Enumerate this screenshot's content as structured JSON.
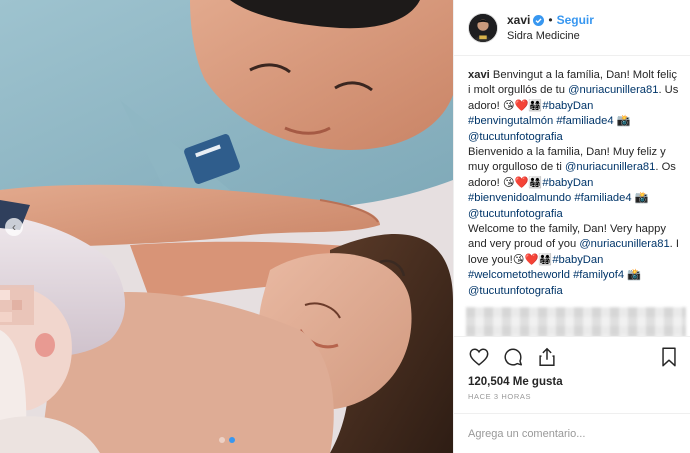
{
  "post": {
    "author": {
      "username": "xavi",
      "verified": true,
      "follow_label": "Seguir",
      "separator": "•",
      "location": "Sidra Medicine"
    },
    "media": {
      "carousel_current": 2,
      "carousel_total": 2,
      "prev_icon": "‹"
    },
    "caption": {
      "username": "xavi",
      "paragraphs": [
        {
          "text": "Benvingut a la família, Dan! Molt feliç i molt orgullós de tu ",
          "mention": "@nuriacunillera81",
          "text2": ". Us adoro! ",
          "emojis": "😘❤️👨‍👩‍👧‍👦",
          "hashtags1": "#babyDan",
          "hashtags2": "#benvingutalmón #familiade4",
          "camera": "📸",
          "credit": "@tucutunfotografia"
        },
        {
          "text": "Bienvenido a la familia, Dan! Muy feliz y muy orgulloso de ti ",
          "mention": "@nuriacunillera81",
          "text2": ". Os adoro! ",
          "emojis": "😘❤️👨‍👩‍👧‍👦",
          "hashtags1": "#babyDan",
          "hashtags2": "#bienvenidoalmundo #familiade4",
          "camera": "📸",
          "credit": "@tucutunfotografia"
        },
        {
          "text": "Welcome to the family, Dan! Very happy and very proud of you ",
          "mention": "@nuriacunillera81",
          "text2": ". I love you!",
          "emojis": "😘❤️👨‍👩‍👧‍👦",
          "hashtags1": "#babyDan",
          "hashtags2": "#welcometotheworld #familyof4",
          "camera": "📸",
          "credit": "@tucutunfotografia"
        }
      ]
    },
    "actions": {
      "like": "heart-icon",
      "comment": "comment-icon",
      "share": "share-icon",
      "save": "bookmark-icon"
    },
    "likes_text": "120,504 Me gusta",
    "timestamp": "HACE 3 HORAS",
    "comment_placeholder": "Agrega un comentario...",
    "colors": {
      "link_blue": "#3897f0",
      "hashtag": "#003569",
      "verified_badge": "#3897f0"
    }
  }
}
